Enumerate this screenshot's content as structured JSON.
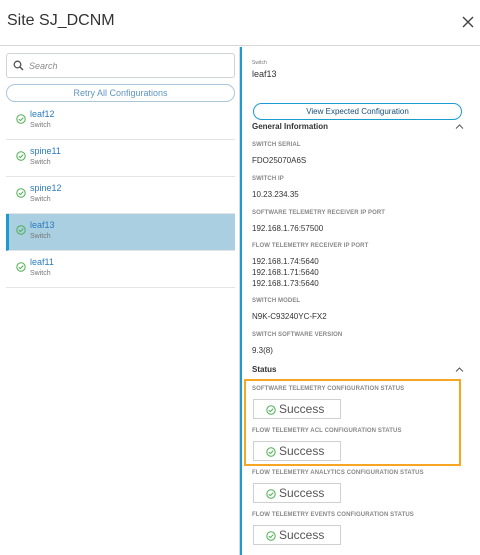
{
  "header": {
    "title": "Site SJ_DCNM"
  },
  "left": {
    "search_placeholder": "Search",
    "retry_label": "Retry All Configurations",
    "items": [
      {
        "name": "leaf12",
        "type": "Switch"
      },
      {
        "name": "spine11",
        "type": "Switch"
      },
      {
        "name": "spine12",
        "type": "Switch"
      },
      {
        "name": "leaf13",
        "type": "Switch"
      },
      {
        "name": "leaf11",
        "type": "Switch"
      }
    ],
    "selected_index": 3
  },
  "right": {
    "switch_label": "Switch",
    "switch_name": "leaf13",
    "view_button": "View Expected Configuration",
    "general_title": "General Information",
    "fields": [
      {
        "label": "SWITCH SERIAL",
        "value": "FDO25070A6S"
      },
      {
        "label": "SWITCH IP",
        "value": "10.23.234.35"
      },
      {
        "label": "SOFTWARE TELEMETRY RECEIVER IP PORT",
        "value": "192.168.1.76:57500"
      },
      {
        "label": "FLOW TELEMETRY RECEIVER IP PORT",
        "lines": [
          "192.168.1.74:5640",
          "192.168.1.71:5640",
          "192.168.1.73:5640"
        ]
      },
      {
        "label": "SWITCH MODEL",
        "value": "N9K-C93240YC-FX2"
      },
      {
        "label": "SWITCH SOFTWARE VERSION",
        "value": "9.3(8)"
      }
    ],
    "status_title": "Status",
    "statuses": [
      {
        "label": "SOFTWARE TELEMETRY CONFIGURATION STATUS",
        "value": "Success"
      },
      {
        "label": "FLOW TELEMETRY ACL CONFIGURATION STATUS",
        "value": "Success"
      },
      {
        "label": "FLOW TELEMETRY ANALYTICS CONFIGURATION STATUS",
        "value": "Success"
      },
      {
        "label": "FLOW TELEMETRY EVENTS CONFIGURATION STATUS",
        "value": "Success"
      }
    ]
  },
  "colors": {
    "accent": "#1c9bd1",
    "success": "#4caf50",
    "highlight": "#f5a623",
    "selected_row": "#a9cfe0"
  },
  "icons": [
    "close-icon",
    "search-icon",
    "check-circle-icon",
    "chevron-up-icon"
  ]
}
